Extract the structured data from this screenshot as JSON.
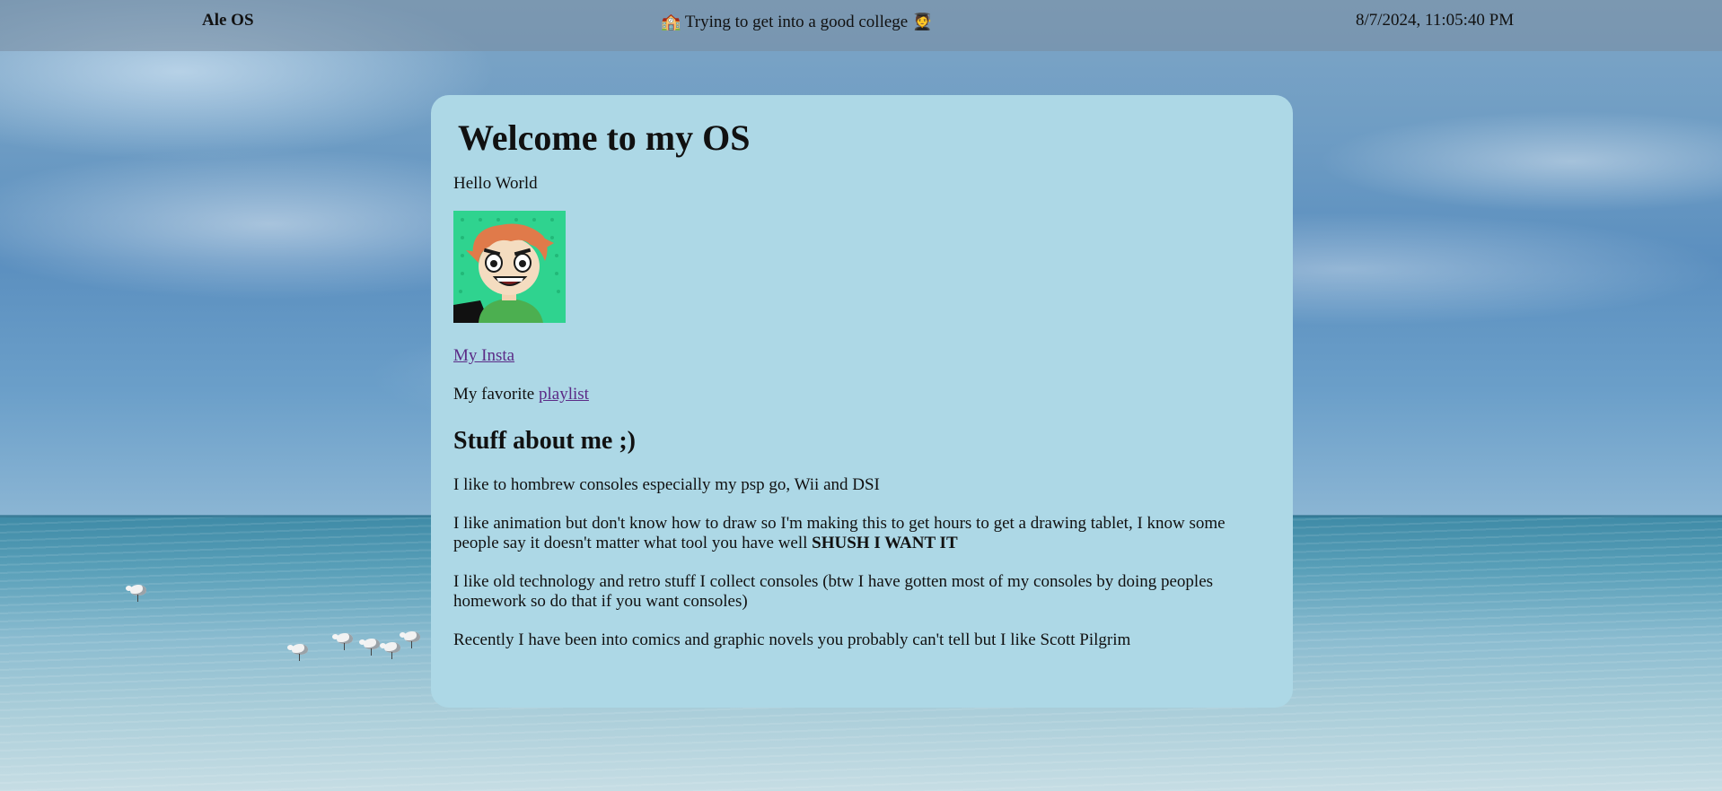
{
  "topbar": {
    "brand": "Ale OS",
    "status_icon_left": "school-icon",
    "status_text": "Trying to get into a good college",
    "status_icon_right": "graduate-icon",
    "clock": "8/7/2024, 11:05:40 PM"
  },
  "window": {
    "title": "Welcome to my OS",
    "hello": "Hello World",
    "avatar_icon": "avatar-portrait",
    "insta_link": "My Insta",
    "favorite_prefix": "My favorite",
    "playlist_link": "playlist",
    "about_heading": "Stuff about me ;)",
    "about": {
      "p1": "I like to hombrew consoles especially my psp go, Wii and DSI",
      "p2_text": "I like animation but don't know how to draw so I'm making this to get hours to get a drawing tablet, I know some people say it doesn't matter what tool you have well",
      "p2_bold": "SHUSH I WANT IT",
      "p3": "I like old technology and retro stuff I collect consoles (btw I have gotten most of my consoles by doing peoples homework so do that if you want consoles)",
      "p4": "Recently I have been into comics and graphic novels you probably can't tell but I like Scott Pilgrim"
    }
  },
  "colors": {
    "window_bg": "#add8e6",
    "link": "#5b2a86",
    "topbar": "#788ca0"
  }
}
